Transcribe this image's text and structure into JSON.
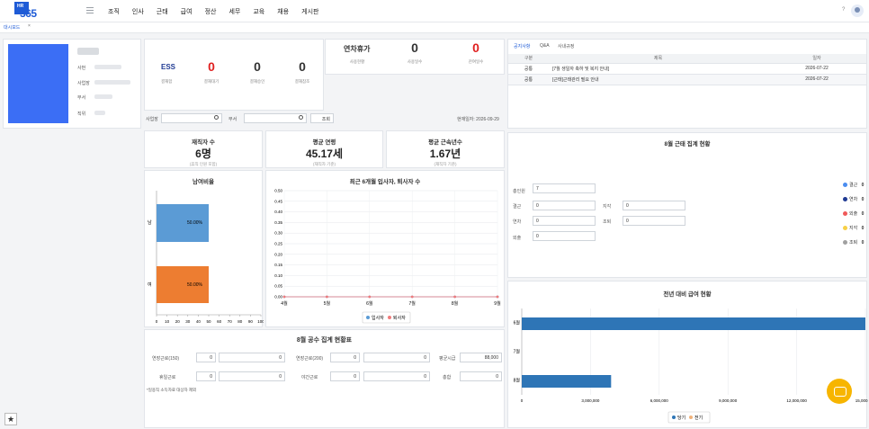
{
  "app": {
    "logo_hr": "HR",
    "logo_num": "365"
  },
  "gnb": [
    "조직",
    "인사",
    "근태",
    "급여",
    "정산",
    "세무",
    "교육",
    "채용",
    "게시판"
  ],
  "header": {
    "help": "?"
  },
  "tabs": {
    "active": "대시보드",
    "close": "×"
  },
  "profile": {
    "fields": [
      "사번",
      "사업장",
      "부서",
      "직위"
    ],
    "photo_color": "#3b6ef5"
  },
  "ess": {
    "label": "ESS",
    "items": [
      {
        "value": "0",
        "caption": "결재함",
        "color": "#e02020"
      },
      {
        "value": "0",
        "caption": "결재승인",
        "color": "#222222"
      },
      {
        "value": "0",
        "caption": "결재참조",
        "color": "#222222"
      }
    ],
    "first_caption": "결재함",
    "caption_pending": "결재대기"
  },
  "leave": {
    "title": "연차휴가",
    "title_caption": "사용현황",
    "used": "0",
    "used_caption": "사용일수",
    "remain": "0",
    "remain_caption": "잔여일수"
  },
  "search": {
    "site_label": "사업장",
    "dept_label": "부서",
    "button": "조회",
    "date_label": "현재일자: 2026-09-29"
  },
  "stats": [
    {
      "title": "재직자 수",
      "value": "6명",
      "sub": "(휴직 인원 포함)"
    },
    {
      "title": "평균 연령",
      "value": "45.17세",
      "sub": "(재직자 기준)"
    },
    {
      "title": "평균 근속년수",
      "value": "1.67년",
      "sub": "(재직자 기준)"
    }
  ],
  "gender": {
    "title": "남여비율",
    "male_label": "남",
    "female_label": "여",
    "male_pct": "50.00%",
    "female_pct": "50.00%",
    "male_color": "#5b9bd5",
    "female_color": "#ed7d31",
    "xticks": [
      "0",
      "10",
      "20",
      "30",
      "40",
      "50",
      "60",
      "70",
      "80",
      "90",
      "100"
    ]
  },
  "hire_chart": {
    "title": "최근 6개월 입사자, 퇴사자 수",
    "months": [
      "4월",
      "5월",
      "6월",
      "7월",
      "8월",
      "9월"
    ],
    "yticks": [
      "0.50",
      "0.45",
      "0.40",
      "0.35",
      "0.30",
      "0.25",
      "0.20",
      "0.15",
      "0.10",
      "0.05",
      "0.00"
    ],
    "legend_hire": "입사자",
    "legend_leave": "퇴사자"
  },
  "notice": {
    "tabs": [
      "공지사항",
      "Q&A",
      "사내규정"
    ],
    "headers": [
      "구분",
      "제목",
      "일자"
    ],
    "rows": [
      [
        "공통",
        "[7월 생일자 축하 및 복지 안내]",
        "2026-07-22"
      ],
      [
        "공통",
        "[근태]근태관리 필요 안내",
        "2026-07-22"
      ]
    ]
  },
  "attendance": {
    "title": "8월 근태 집계 현황",
    "total_label": "총인원",
    "total": "7",
    "fields": [
      {
        "label": "결근",
        "value": "0"
      },
      {
        "label": "지각",
        "value": "0"
      },
      {
        "label": "연차",
        "value": "0"
      },
      {
        "label": "조퇴",
        "value": "0"
      },
      {
        "label": "외출",
        "value": "0"
      }
    ],
    "legend": [
      {
        "label": "결근",
        "value": "0",
        "color": "#4a8df0"
      },
      {
        "label": "연차",
        "value": "0",
        "color": "#1f3a93"
      },
      {
        "label": "외출",
        "value": "0",
        "color": "#f05a5a"
      },
      {
        "label": "지각",
        "value": "0",
        "color": "#f7d046"
      },
      {
        "label": "조퇴",
        "value": "0",
        "color": "#a0a0a0"
      }
    ]
  },
  "worktime": {
    "title": "8월 공수 집계 현황표",
    "r1": [
      "연장근로(150)",
      "0",
      "0",
      "연장근로(200)",
      "0",
      "0",
      "평균시급",
      "88,000"
    ],
    "r2": [
      "휴일근로",
      "0",
      "0",
      "야간근로",
      "0",
      "0",
      "총합",
      "0"
    ],
    "note": "*일용직 소득자료 대상자 제외"
  },
  "pay_chart": {
    "title": "전년 대비 급여 현황",
    "legend_cur": "당기",
    "legend_prev": "전기",
    "cur_color": "#2e75b6",
    "prev_color": "#f0b27a"
  },
  "chart_data": [
    {
      "type": "bar",
      "title": "남여비율",
      "categories": [
        "남",
        "여"
      ],
      "values": [
        50,
        50
      ],
      "xlim": [
        0,
        100
      ],
      "orientation": "horizontal"
    },
    {
      "type": "line",
      "title": "최근 6개월 입사자, 퇴사자 수",
      "x": [
        "4월",
        "5월",
        "6월",
        "7월",
        "8월",
        "9월"
      ],
      "series": [
        {
          "name": "입사자",
          "values": [
            0,
            0,
            0,
            0,
            0,
            0
          ]
        },
        {
          "name": "퇴사자",
          "values": [
            0,
            0,
            0,
            0,
            0,
            0
          ]
        }
      ],
      "ylim": [
        0,
        0.5
      ],
      "legend": "bottom"
    },
    {
      "type": "bar",
      "title": "전년 대비 급여 현황",
      "categories": [
        "6월",
        "7월",
        "8월"
      ],
      "series": [
        {
          "name": "당기",
          "values": [
            15000000,
            0,
            3900000
          ]
        },
        {
          "name": "전기",
          "values": [
            0,
            0,
            0
          ]
        }
      ],
      "xticks": [
        "0",
        "3,000,000",
        "6,000,000",
        "9,000,000",
        "12,000,000",
        "15,000,000"
      ],
      "xlim": [
        0,
        15000000
      ],
      "orientation": "horizontal",
      "legend": "bottom"
    }
  ]
}
